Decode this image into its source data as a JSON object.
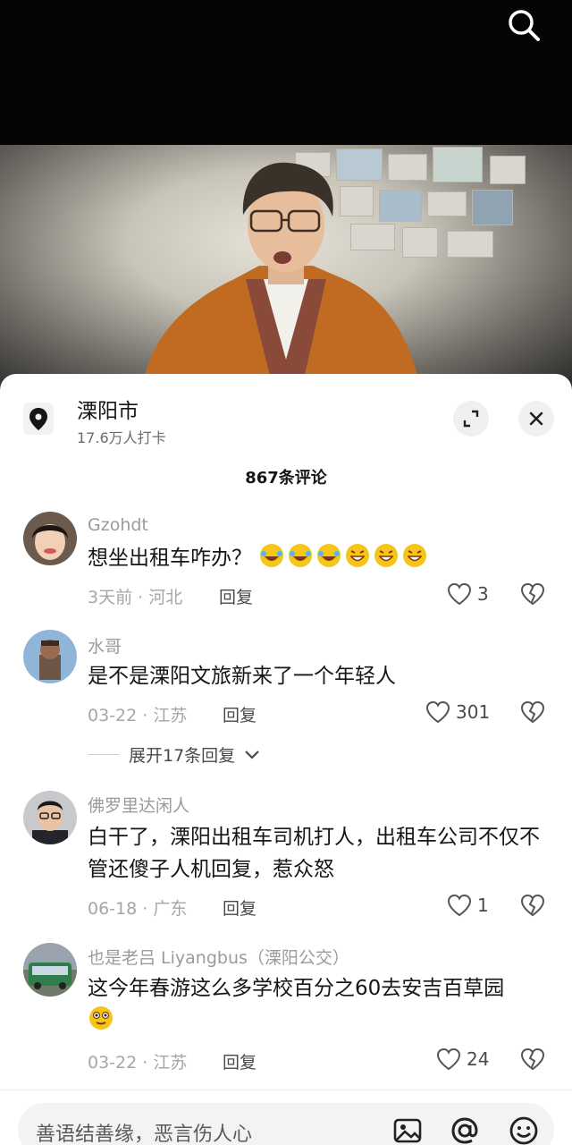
{
  "location": {
    "name": "溧阳市",
    "checkins": "17.6万人打卡"
  },
  "comments_header": {
    "count_label": "867条评论"
  },
  "comments": [
    {
      "username": "Gzohdt",
      "text": "想坐出租车咋办？",
      "time": "3天前",
      "region": "河北",
      "reply_label": "回复",
      "likes": "3"
    },
    {
      "username": "水哥",
      "text": "是不是溧阳文旅新来了一个年轻人",
      "time": "03-22",
      "region": "江苏",
      "reply_label": "回复",
      "likes": "301"
    },
    {
      "username": "佛罗里达闲人",
      "text": "白干了，溧阳出租车司机打人，出租车公司不仅不管还傻子人机回复，惹众怒",
      "time": "06-18",
      "region": "广东",
      "reply_label": "回复",
      "likes": "1"
    },
    {
      "username": "也是老吕 Liyangbus（溧阳公交）",
      "text": "这今年春游这么多学校百分之60去安吉百草园",
      "time": "03-22",
      "region": "江苏",
      "reply_label": "回复",
      "likes": "24"
    }
  ],
  "expand_replies": {
    "label": "展开17条回复"
  },
  "input": {
    "placeholder": "善语结善缘，恶言伤人心"
  },
  "meta_separator": "·",
  "colors": {
    "like_outline": "#555555",
    "sheet_bg": "#ffffff",
    "jacket": "#c06a22"
  }
}
